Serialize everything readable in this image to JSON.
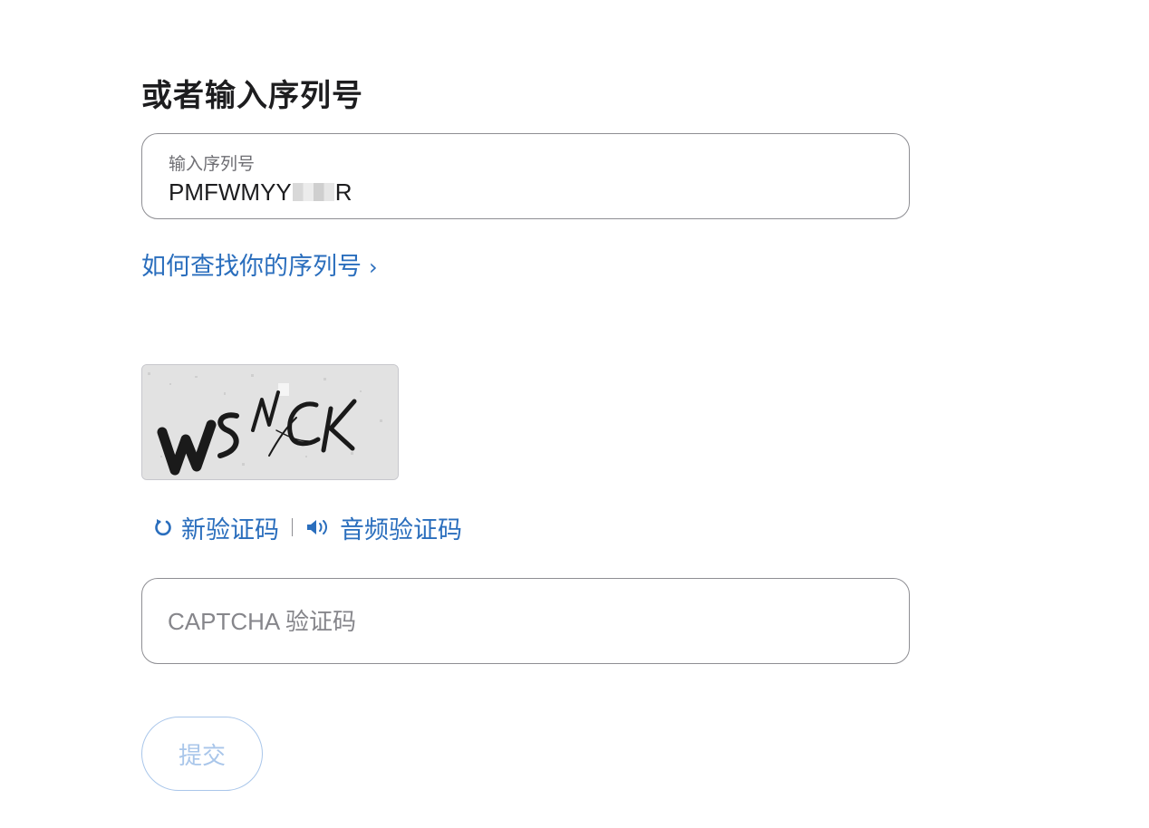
{
  "title": "或者输入序列号",
  "serial": {
    "label": "输入序列号",
    "value_prefix": "PMFWMYY",
    "value_suffix": "R"
  },
  "find_serial_link": "如何查找你的序列号",
  "captcha": {
    "image_text": "WSMCK",
    "refresh_label": "新验证码",
    "audio_label": "音频验证码",
    "input_placeholder": "CAPTCHA 验证码",
    "input_value": ""
  },
  "submit_label": "提交",
  "colors": {
    "link": "#2a6ebd",
    "text": "#1d1d1f",
    "border": "#8e8e93",
    "submit_disabled": "#a9c6ea"
  },
  "icons": {
    "find_chevron": "chevron-right-icon",
    "refresh": "refresh-icon",
    "audio": "speaker-icon"
  }
}
